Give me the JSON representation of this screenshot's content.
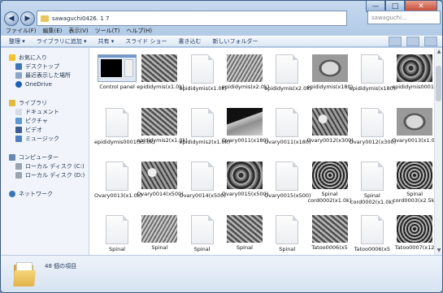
{
  "window": {
    "address": "sawaguchi0426. 1 7",
    "search_placeholder": "sawaguchi...",
    "minimize": "—",
    "maximize": "□",
    "close": "✕"
  },
  "menu": [
    "ファイル(F)",
    "編集(E)",
    "表示(V)",
    "ツール(T)",
    "ヘルプ(H)"
  ],
  "toolbar": [
    "整理 ▾",
    "ライブラリに追加 ▾",
    "共有 ▾",
    "スライド ショー",
    "書き込む",
    "新しいフォルダー"
  ],
  "sidebar": {
    "favorites": "お気に入り",
    "desktop": "デスクトップ",
    "recent": "最近表示した場所",
    "onedrive": "OneDrive",
    "libraries": "ライブラリ",
    "documents": "ドキュメント",
    "pictures": "ピクチャ",
    "videos": "ビデオ",
    "music": "ミュージック",
    "computer": "コンピューター",
    "disk_c": "ローカル ディスク (C:)",
    "disk_d": "ローカル ディスク (D:)",
    "network": "ネットワーク"
  },
  "files": [
    {
      "name": "Control panel",
      "kind": "cp"
    },
    {
      "name": "epididymis(x1.0k)",
      "kind": "tx1"
    },
    {
      "name": "epididymis(x1.0k)",
      "kind": "doc"
    },
    {
      "name": "epididymis(x2.0k)",
      "kind": "tx3"
    },
    {
      "name": "epididymis(x2.0k)",
      "kind": "doc"
    },
    {
      "name": "epididymis(x180)",
      "kind": "tx5"
    },
    {
      "name": "epididymis(x180)",
      "kind": "doc"
    },
    {
      "name": "epididymis0001(x5.0k)",
      "kind": "tx2"
    },
    {
      "name": "epididymis0001(x5.0k)",
      "kind": "doc"
    },
    {
      "name": "epididymis2(x1.0k)",
      "kind": "tx1"
    },
    {
      "name": "epididymis2(x1.0k)",
      "kind": "doc"
    },
    {
      "name": "Ovary0011(x180)",
      "kind": "tx7"
    },
    {
      "name": "Ovary0011(x180)",
      "kind": "doc"
    },
    {
      "name": "Ovary0012(x300)",
      "kind": "tx4"
    },
    {
      "name": "Ovary0012(x300)",
      "kind": "doc"
    },
    {
      "name": "Ovary0013(x1.0k)",
      "kind": "tx5"
    },
    {
      "name": "Ovary0013(x1.0k)",
      "kind": "doc"
    },
    {
      "name": "Ovary0014(x500)",
      "kind": "tx4"
    },
    {
      "name": "Ovary0014(x500)",
      "kind": "doc"
    },
    {
      "name": "Ovary0015(x500)",
      "kind": "tx2"
    },
    {
      "name": "Ovary0015(x500)",
      "kind": "doc"
    },
    {
      "name": "Spinal cord0002(x1.0k)",
      "kind": "tx6"
    },
    {
      "name": "Spinal cord0002(x1.0k)",
      "kind": "doc"
    },
    {
      "name": "Spinal cord0003(x2.5k)",
      "kind": "tx6"
    },
    {
      "name": "Spinal",
      "kind": "doc"
    },
    {
      "name": "Spinal",
      "kind": "tx3"
    },
    {
      "name": "Spinal",
      "kind": "doc"
    },
    {
      "name": "Spinal",
      "kind": "tx1"
    },
    {
      "name": "Spinal",
      "kind": "doc"
    },
    {
      "name": "Tatoo0006(x5",
      "kind": "tx1"
    },
    {
      "name": "Tatoo0006(x5",
      "kind": "doc"
    },
    {
      "name": "Tatoo0007(x12",
      "kind": "tx6"
    }
  ],
  "status": {
    "count": "48 個の項目"
  }
}
